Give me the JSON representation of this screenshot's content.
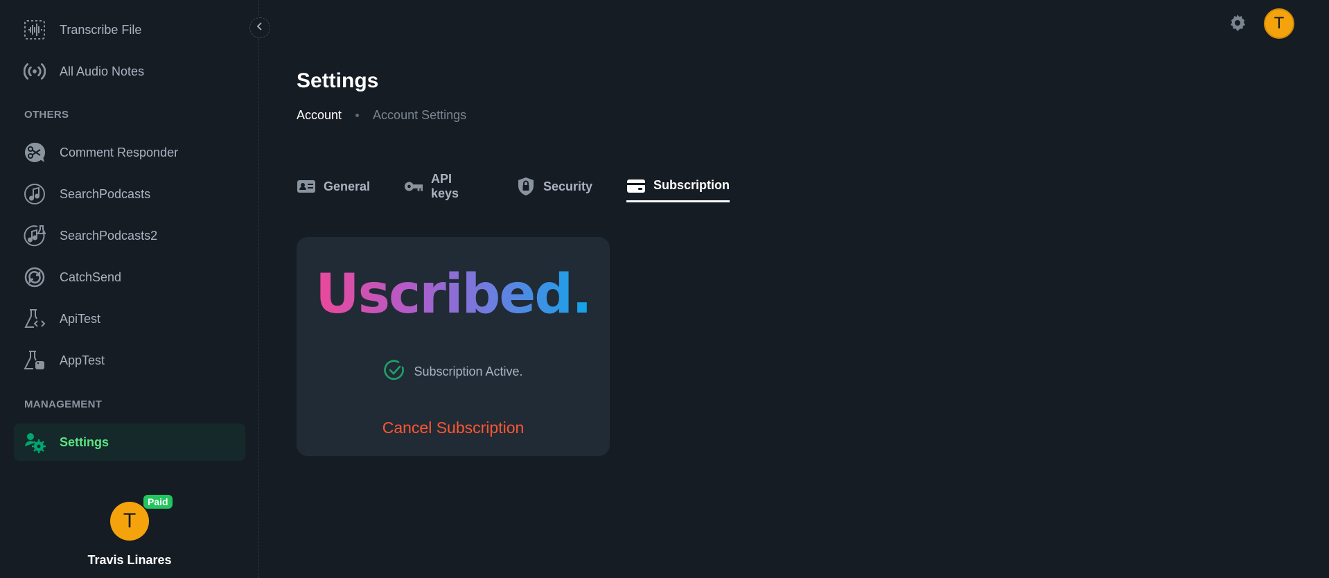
{
  "sidebar": {
    "top_items": [
      {
        "label": "Transcribe File",
        "icon": "waveform-icon"
      },
      {
        "label": "All Audio Notes",
        "icon": "broadcast-icon"
      }
    ],
    "others_header": "OTHERS",
    "others_items": [
      {
        "label": "Comment Responder",
        "icon": "scissors-chat-icon"
      },
      {
        "label": "SearchPodcasts",
        "icon": "music-note-icon"
      },
      {
        "label": "SearchPodcasts2",
        "icon": "music-note-flask-icon"
      },
      {
        "label": "CatchSend",
        "icon": "sync-circle-icon"
      },
      {
        "label": "ApiTest",
        "icon": "flask-code-icon"
      },
      {
        "label": "AppTest",
        "icon": "flask-python-icon"
      }
    ],
    "management_header": "MANAGEMENT",
    "management_items": [
      {
        "label": "Settings",
        "icon": "settings-cog-icon",
        "active": true
      }
    ],
    "user": {
      "initial": "T",
      "badge": "Paid",
      "name": "Travis Linares"
    }
  },
  "topbar": {
    "avatar_initial": "T"
  },
  "page": {
    "title": "Settings",
    "breadcrumb": [
      "Account",
      "Account Settings"
    ],
    "tabs": [
      {
        "label": "General",
        "icon": "id-card-icon"
      },
      {
        "label": "API keys",
        "icon": "key-icon"
      },
      {
        "label": "Security",
        "icon": "shield-lock-icon"
      },
      {
        "label": "Subscription",
        "icon": "credit-card-icon",
        "active": true
      }
    ]
  },
  "subscription_card": {
    "logo_text": "Uscribed.",
    "status_text": "Subscription Active.",
    "cancel_label": "Cancel Subscription"
  },
  "colors": {
    "background": "#161c24",
    "card": "#212b36",
    "accent_green": "#5be584",
    "danger": "#ff5630",
    "avatar": "#f5a30c",
    "badge": "#22c55e"
  }
}
